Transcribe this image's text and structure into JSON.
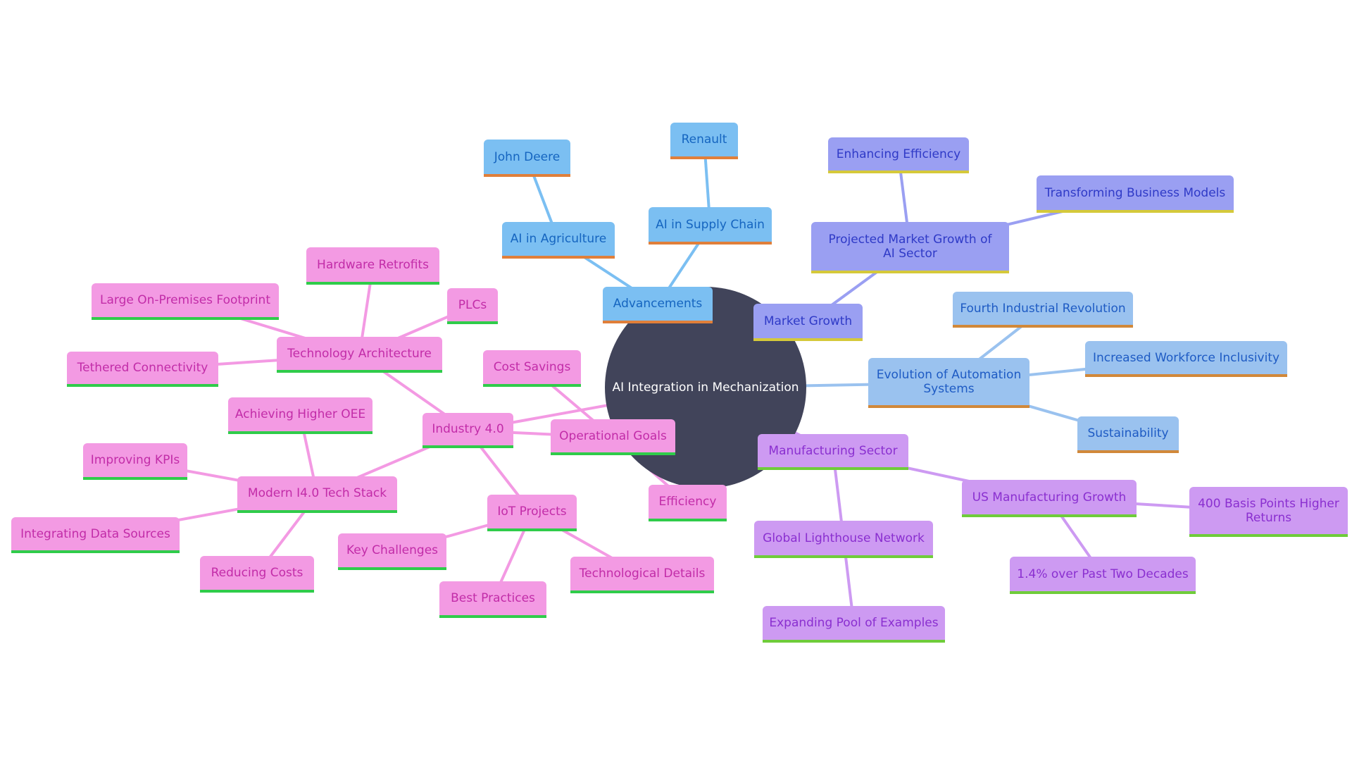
{
  "diagram": {
    "type": "mindmap",
    "root": {
      "id": "root",
      "label": "AI Integration in Mechanization"
    },
    "colors": {
      "root_fill": "#41445a",
      "advancements": {
        "fill": "#7bbff2",
        "text": "#1565c0",
        "underline": "#e07f3a"
      },
      "market_growth": {
        "fill": "#9a9ff2",
        "text": "#2f3ac7",
        "underline": "#d5c93a"
      },
      "evolution": {
        "fill": "#9ac2ef",
        "text": "#1e5bc4",
        "underline": "#d1883a"
      },
      "manufacturing": {
        "fill": "#cd9af2",
        "text": "#8a2fd0",
        "underline": "#6fcc3a"
      },
      "industry": {
        "fill": "#f39ae3",
        "text": "#c22ca8",
        "underline": "#2fcc4a"
      }
    },
    "nodes": [
      {
        "id": "advancements",
        "label": "Advancements",
        "parent": "root",
        "branch": "advancements"
      },
      {
        "id": "ai-agriculture",
        "label": "AI in Agriculture",
        "parent": "advancements",
        "branch": "advancements"
      },
      {
        "id": "john-deere",
        "label": "John Deere",
        "parent": "ai-agriculture",
        "branch": "advancements"
      },
      {
        "id": "ai-supply-chain",
        "label": "AI in Supply Chain",
        "parent": "advancements",
        "branch": "advancements"
      },
      {
        "id": "renault",
        "label": "Renault",
        "parent": "ai-supply-chain",
        "branch": "advancements"
      },
      {
        "id": "market-growth",
        "label": "Market Growth",
        "parent": "root",
        "branch": "market_growth"
      },
      {
        "id": "projected-market-growth",
        "label": "Projected Market Growth of AI Sector",
        "parent": "market-growth",
        "branch": "market_growth"
      },
      {
        "id": "enhancing-efficiency",
        "label": "Enhancing Efficiency",
        "parent": "projected-market-growth",
        "branch": "market_growth"
      },
      {
        "id": "transforming-business-models",
        "label": "Transforming Business Models",
        "parent": "projected-market-growth",
        "branch": "market_growth"
      },
      {
        "id": "evolution-automation",
        "label": "Evolution of Automation Systems",
        "parent": "root",
        "branch": "evolution"
      },
      {
        "id": "fourth-industrial-revolution",
        "label": "Fourth Industrial Revolution",
        "parent": "evolution-automation",
        "branch": "evolution"
      },
      {
        "id": "increased-workforce-inclusivity",
        "label": "Increased Workforce Inclusivity",
        "parent": "evolution-automation",
        "branch": "evolution"
      },
      {
        "id": "sustainability",
        "label": "Sustainability",
        "parent": "evolution-automation",
        "branch": "evolution"
      },
      {
        "id": "manufacturing-sector",
        "label": "Manufacturing Sector",
        "parent": "root",
        "branch": "manufacturing"
      },
      {
        "id": "us-manufacturing-growth",
        "label": "US Manufacturing Growth",
        "parent": "manufacturing-sector",
        "branch": "manufacturing"
      },
      {
        "id": "basis-points",
        "label": "400 Basis Points Higher Returns",
        "parent": "us-manufacturing-growth",
        "branch": "manufacturing"
      },
      {
        "id": "past-two-decades",
        "label": "1.4% over Past Two Decades",
        "parent": "us-manufacturing-growth",
        "branch": "manufacturing"
      },
      {
        "id": "global-lighthouse-network",
        "label": "Global Lighthouse Network",
        "parent": "manufacturing-sector",
        "branch": "manufacturing"
      },
      {
        "id": "expanding-pool",
        "label": "Expanding Pool of Examples",
        "parent": "global-lighthouse-network",
        "branch": "manufacturing"
      },
      {
        "id": "industry-40",
        "label": "Industry 4.0",
        "parent": "root",
        "branch": "industry"
      },
      {
        "id": "technology-architecture",
        "label": "Technology Architecture",
        "parent": "industry-40",
        "branch": "industry"
      },
      {
        "id": "hardware-retrofits",
        "label": "Hardware Retrofits",
        "parent": "technology-architecture",
        "branch": "industry"
      },
      {
        "id": "large-footprint",
        "label": "Large On-Premises Footprint",
        "parent": "technology-architecture",
        "branch": "industry"
      },
      {
        "id": "plcs",
        "label": "PLCs",
        "parent": "technology-architecture",
        "branch": "industry"
      },
      {
        "id": "tethered-connectivity",
        "label": "Tethered Connectivity",
        "parent": "technology-architecture",
        "branch": "industry"
      },
      {
        "id": "operational-goals",
        "label": "Operational Goals",
        "parent": "industry-40",
        "branch": "industry"
      },
      {
        "id": "cost-savings",
        "label": "Cost Savings",
        "parent": "operational-goals",
        "branch": "industry"
      },
      {
        "id": "efficiency",
        "label": "Efficiency",
        "parent": "operational-goals",
        "branch": "industry"
      },
      {
        "id": "modern-tech-stack",
        "label": "Modern I4.0 Tech Stack",
        "parent": "industry-40",
        "branch": "industry"
      },
      {
        "id": "achieving-higher-oee",
        "label": "Achieving Higher OEE",
        "parent": "modern-tech-stack",
        "branch": "industry"
      },
      {
        "id": "improving-kpis",
        "label": "Improving KPIs",
        "parent": "modern-tech-stack",
        "branch": "industry"
      },
      {
        "id": "integrating-data-sources",
        "label": "Integrating Data Sources",
        "parent": "modern-tech-stack",
        "branch": "industry"
      },
      {
        "id": "reducing-costs",
        "label": "Reducing Costs",
        "parent": "modern-tech-stack",
        "branch": "industry"
      },
      {
        "id": "iot-projects",
        "label": "IoT Projects",
        "parent": "industry-40",
        "branch": "industry"
      },
      {
        "id": "key-challenges",
        "label": "Key Challenges",
        "parent": "iot-projects",
        "branch": "industry"
      },
      {
        "id": "best-practices",
        "label": "Best Practices",
        "parent": "iot-projects",
        "branch": "industry"
      },
      {
        "id": "technological-details",
        "label": "Technological Details",
        "parent": "iot-projects",
        "branch": "industry"
      }
    ]
  }
}
